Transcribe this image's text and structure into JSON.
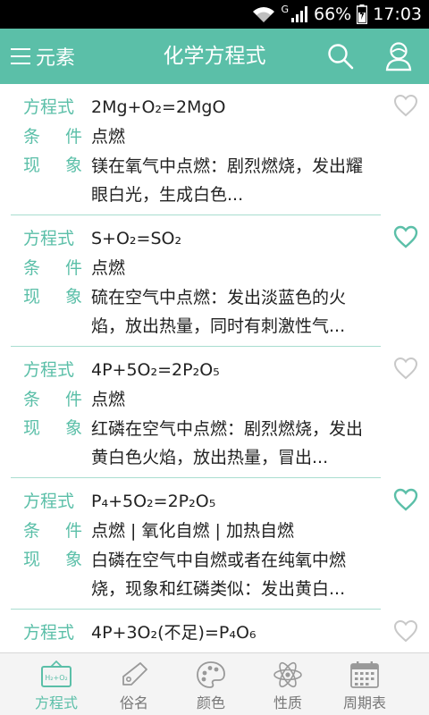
{
  "status_bar": {
    "network_type": "G",
    "battery": "66%",
    "time": "17:03"
  },
  "app_bar": {
    "menu_label": "元素",
    "title": "化学方程式",
    "icons": [
      "menu-icon",
      "search-icon",
      "user-icon"
    ]
  },
  "labels": {
    "equation": "方程式",
    "condition": [
      "条",
      "件"
    ],
    "phenomenon": [
      "现",
      "象"
    ]
  },
  "entries": [
    {
      "equation": "2Mg+O₂=2MgO",
      "condition": "点燃",
      "phenomenon": "镁在氧气中点燃：剧烈燃烧，发出耀眼白光，生成白色...",
      "favorited": false
    },
    {
      "equation": "S+O₂=SO₂",
      "condition": "点燃",
      "phenomenon": "硫在空气中点燃：发出淡蓝色的火焰，放出热量，同时有刺激性气...",
      "favorited": true
    },
    {
      "equation": "4P+5O₂=2P₂O₅",
      "condition": "点燃",
      "phenomenon": "红磷在空气中点燃：剧烈燃烧，发出黄白色火焰，放出热量，冒出...",
      "favorited": false
    },
    {
      "equation": "P₄+5O₂=2P₂O₅",
      "condition": "点燃 | 氧化自燃 | 加热自燃",
      "phenomenon": "白磷在空气中自燃或者在纯氧中燃烧，现象和红磷类似：发出黄白...",
      "favorited": true
    },
    {
      "equation": "4P+3O₂(不足)=P₄O₆",
      "condition": "",
      "phenomenon": "",
      "favorited": false
    }
  ],
  "tabs": [
    {
      "label": "方程式",
      "icon": "equation-board-icon",
      "icon_text": "H₂+O₂",
      "active": true
    },
    {
      "label": "俗名",
      "icon": "tag-icon",
      "active": false
    },
    {
      "label": "颜色",
      "icon": "palette-icon",
      "active": false
    },
    {
      "label": "性质",
      "icon": "atom-icon",
      "active": false
    },
    {
      "label": "周期表",
      "icon": "calendar-icon",
      "active": false
    }
  ],
  "colors": {
    "accent": "#5bbfa8",
    "divider": "#a9ddd0",
    "heart_off": "#c8c8c8"
  }
}
